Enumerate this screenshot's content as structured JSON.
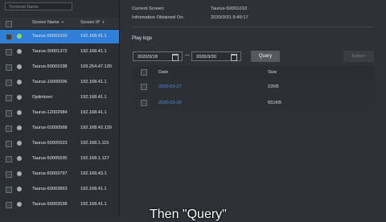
{
  "sidebar": {
    "search_placeholder": "Terminal Name",
    "headers": {
      "name": "Screen Name",
      "ip": "Screen IP"
    },
    "screens": [
      {
        "name": "Taurus-50001010",
        "ip": "192.168.41.1",
        "online": true,
        "selected": true
      },
      {
        "name": "Taurus-30001372",
        "ip": "192.168.41.1",
        "online": false,
        "selected": false
      },
      {
        "name": "Taurus-50001038",
        "ip": "169.254.47.120",
        "online": false,
        "selected": false
      },
      {
        "name": "Taurus-10000006",
        "ip": "192.168.41.1",
        "online": false,
        "selected": false
      },
      {
        "name": "Optimizen",
        "ip": "192.168.41.1",
        "online": false,
        "selected": false
      },
      {
        "name": "Taurus-12002984",
        "ip": "192.168.41.1",
        "online": false,
        "selected": false
      },
      {
        "name": "Taurus-02000568",
        "ip": "192.168.42.129",
        "online": false,
        "selected": false
      },
      {
        "name": "Taurus-50005523",
        "ip": "192.168.1.115",
        "online": false,
        "selected": false
      },
      {
        "name": "Taurus-50005535",
        "ip": "192.168.1.127",
        "online": false,
        "selected": false
      },
      {
        "name": "Taurus-60003797",
        "ip": "192.168.43.1",
        "online": false,
        "selected": false
      },
      {
        "name": "Taurus-60003863",
        "ip": "192.168.41.1",
        "online": false,
        "selected": false
      },
      {
        "name": "Taurus-50003028",
        "ip": "192.168.41.1",
        "online": false,
        "selected": false
      }
    ]
  },
  "info": {
    "current_label": "Current Screen:",
    "current_value": "Taurus-50001010",
    "obtained_label": "Information Obtained On:",
    "obtained_value": "2020/3/31 9:49:17"
  },
  "playlogs": {
    "title": "Play logs",
    "date_from": "2020/3/18",
    "date_to": "2020/3/30",
    "separator": "—",
    "query_label": "Query",
    "export_label": "Export",
    "columns": {
      "date": "Date",
      "size": "Size"
    },
    "rows": [
      {
        "date": "2020-03-27",
        "size": "22KB"
      },
      {
        "date": "2020-03-30",
        "size": "651KB"
      }
    ]
  },
  "caption": "Then \"Query\""
}
